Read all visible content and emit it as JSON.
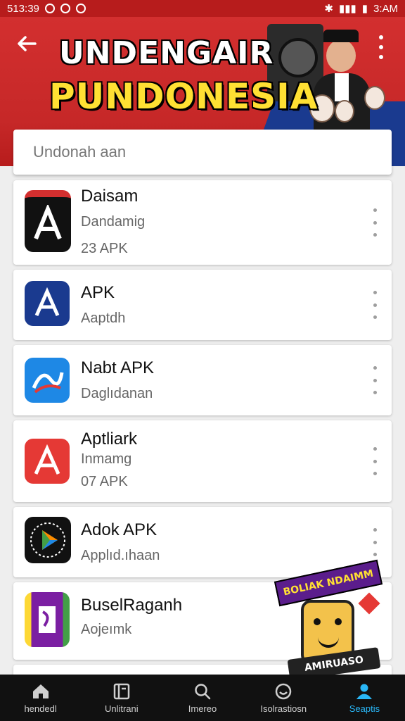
{
  "status_bar": {
    "time_left": "513:39",
    "time_right": "3:AM"
  },
  "header": {
    "title_line1": "UNDENGAIR",
    "title_line2": "PUNDONESIA"
  },
  "search": {
    "placeholder": "Undonah aan"
  },
  "apps": [
    {
      "name": "Daisam",
      "subtitle": "Dandamig",
      "meta": "23 APK",
      "icon_color": "#111111",
      "icon_label": "APK"
    },
    {
      "name": "APK",
      "subtitle": "Aaptdh",
      "meta": "",
      "icon_color": "#1a3a8f",
      "icon_label": "APK"
    },
    {
      "name": "Nabt APK",
      "subtitle": "Daglıdanan",
      "meta": "",
      "icon_color": "#1e88e5",
      "icon_label": ""
    },
    {
      "name": "Aptliark",
      "subtitle": "Inmamg",
      "meta": "07 APK",
      "icon_color": "#e53935",
      "icon_label": "AOPK"
    },
    {
      "name": "Adok APK",
      "subtitle": "Applıd.ıhaan",
      "meta": "",
      "icon_color": "#111111",
      "icon_label": ""
    },
    {
      "name": "BuselRaganh",
      "subtitle": "",
      "meta": "Aojeımk",
      "icon_color": "#7b1fa2",
      "icon_label": "RODKS"
    }
  ],
  "sticker": {
    "banner_text": "BOLIAK NDAIMM",
    "label_text": "AMIRUASO"
  },
  "bottom_nav": [
    {
      "label": "hendedl",
      "icon": "home-icon"
    },
    {
      "label": "Unlitrani",
      "icon": "book-icon"
    },
    {
      "label": "Imereo",
      "icon": "search-icon"
    },
    {
      "label": "Isolrastiosn",
      "icon": "smile-icon"
    },
    {
      "label": "Seaptis",
      "icon": "person-icon"
    }
  ],
  "colors": {
    "header_red": "#d32f2f",
    "banner_yellow": "#ffe033",
    "active_nav": "#29b6f6"
  }
}
